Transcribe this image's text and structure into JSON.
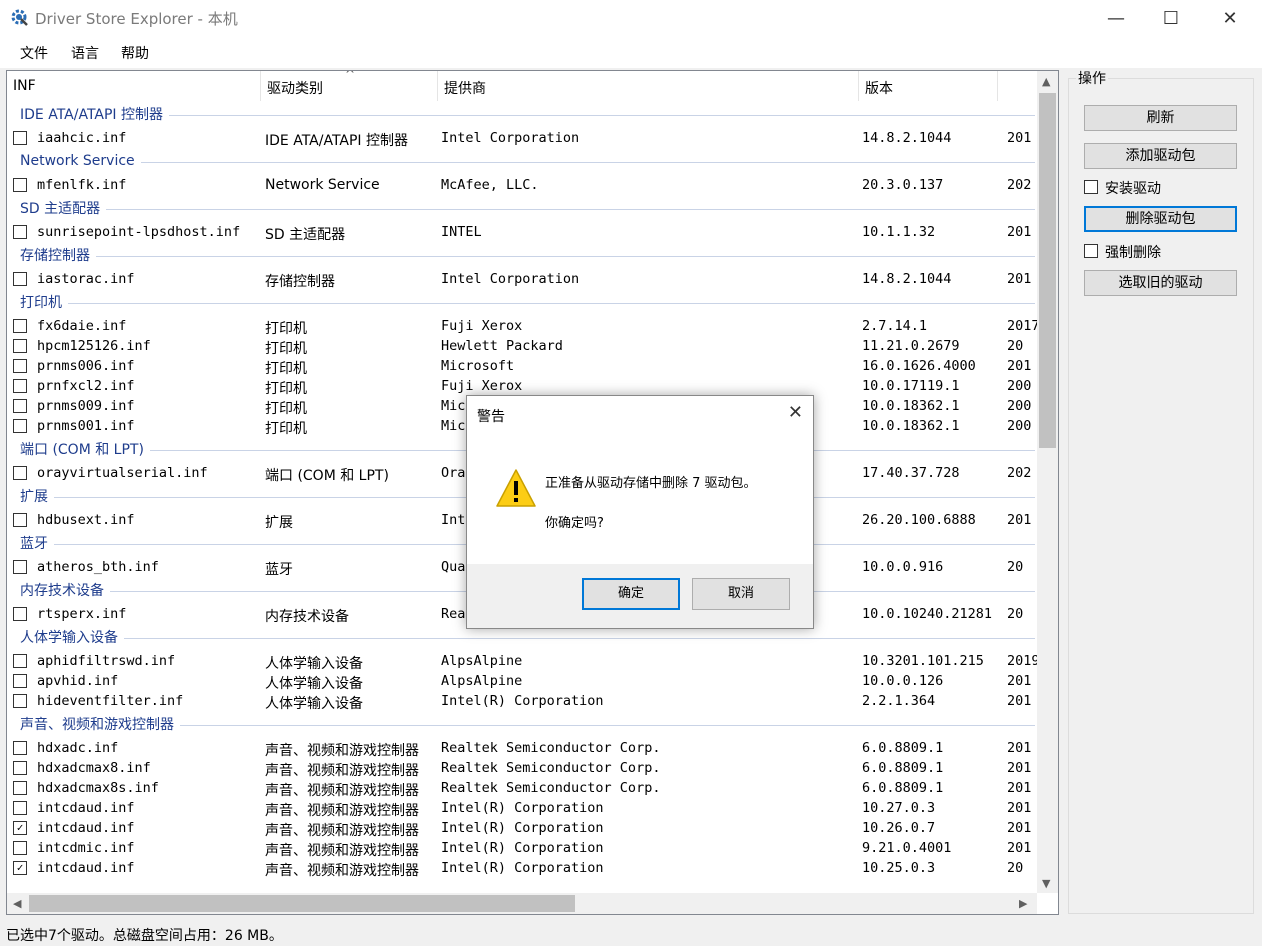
{
  "window": {
    "title": "Driver Store Explorer - 本机",
    "minimize": "—",
    "maximize": "☐",
    "close": "✕"
  },
  "menu": [
    "文件",
    "语言",
    "帮助"
  ],
  "columns": {
    "inf": "INF",
    "type": "驱动类别",
    "provider": "提供商",
    "version": "版本",
    "sort_indicator": "^"
  },
  "list": [
    {
      "group": "IDE ATA/ATAPI 控制器"
    },
    {
      "inf": "iaahcic.inf",
      "type": "IDE ATA/ATAPI 控制器",
      "provider": "Intel Corporation",
      "version": "14.8.2.1044",
      "date": "201",
      "checked": false
    },
    {
      "group": "Network Service"
    },
    {
      "inf": "mfenlfk.inf",
      "type": "Network Service",
      "provider": "McAfee, LLC.",
      "version": "20.3.0.137",
      "date": "202",
      "checked": false
    },
    {
      "group": "SD 主适配器"
    },
    {
      "inf": "sunrisepoint-lpsdhost.inf",
      "type": "SD 主适配器",
      "provider": "INTEL",
      "version": "10.1.1.32",
      "date": "201",
      "checked": false
    },
    {
      "group": "存储控制器"
    },
    {
      "inf": "iastorac.inf",
      "type": "存储控制器",
      "provider": "Intel Corporation",
      "version": "14.8.2.1044",
      "date": "201",
      "checked": false
    },
    {
      "group": "打印机"
    },
    {
      "inf": "fx6daie.inf",
      "type": "打印机",
      "provider": "Fuji Xerox",
      "version": "2.7.14.1",
      "date": "2017",
      "checked": false
    },
    {
      "inf": "hpcm125126.inf",
      "type": "打印机",
      "provider": "Hewlett Packard",
      "version": "11.21.0.2679",
      "date": "20",
      "checked": false
    },
    {
      "inf": "prnms006.inf",
      "type": "打印机",
      "provider": "Microsoft",
      "version": "16.0.1626.4000",
      "date": "201",
      "checked": false
    },
    {
      "inf": "prnfxcl2.inf",
      "type": "打印机",
      "provider": "Fuji Xerox",
      "version": "10.0.17119.1",
      "date": "200",
      "checked": false
    },
    {
      "inf": "prnms009.inf",
      "type": "打印机",
      "provider": "Mic",
      "version": "10.0.18362.1",
      "date": "200",
      "checked": false
    },
    {
      "inf": "prnms001.inf",
      "type": "打印机",
      "provider": "Mic",
      "version": "10.0.18362.1",
      "date": "200",
      "checked": false
    },
    {
      "group": "端口 (COM 和 LPT)"
    },
    {
      "inf": "orayvirtualserial.inf",
      "type": "端口 (COM 和 LPT)",
      "provider": "Ora",
      "version": "17.40.37.728",
      "date": "202",
      "checked": false
    },
    {
      "group": "扩展"
    },
    {
      "inf": "hdbusext.inf",
      "type": "扩展",
      "provider": "Int",
      "version": "26.20.100.6888",
      "date": "201",
      "checked": false
    },
    {
      "group": "蓝牙"
    },
    {
      "inf": "atheros_bth.inf",
      "type": "蓝牙",
      "provider": "Qua",
      "version": "10.0.0.916",
      "date": "20",
      "checked": false
    },
    {
      "group": "内存技术设备"
    },
    {
      "inf": "rtsperx.inf",
      "type": "内存技术设备",
      "provider": "Realtek Semiconduct Corp.",
      "version": "10.0.10240.21281",
      "date": "20",
      "checked": false
    },
    {
      "group": "人体学输入设备"
    },
    {
      "inf": "aphidfiltrswd.inf",
      "type": "人体学输入设备",
      "provider": "AlpsAlpine",
      "version": "10.3201.101.215",
      "date": "2019",
      "checked": false
    },
    {
      "inf": "apvhid.inf",
      "type": "人体学输入设备",
      "provider": "AlpsAlpine",
      "version": "10.0.0.126",
      "date": "201",
      "checked": false
    },
    {
      "inf": "hideventfilter.inf",
      "type": "人体学输入设备",
      "provider": "Intel(R) Corporation",
      "version": "2.2.1.364",
      "date": "201",
      "checked": false
    },
    {
      "group": "声音、视频和游戏控制器"
    },
    {
      "inf": "hdxadc.inf",
      "type": "声音、视频和游戏控制器",
      "provider": "Realtek Semiconductor Corp.",
      "version": "6.0.8809.1",
      "date": "201",
      "checked": false
    },
    {
      "inf": "hdxadcmax8.inf",
      "type": "声音、视频和游戏控制器",
      "provider": "Realtek Semiconductor Corp.",
      "version": "6.0.8809.1",
      "date": "201",
      "checked": false
    },
    {
      "inf": "hdxadcmax8s.inf",
      "type": "声音、视频和游戏控制器",
      "provider": "Realtek Semiconductor Corp.",
      "version": "6.0.8809.1",
      "date": "201",
      "checked": false
    },
    {
      "inf": "intcdaud.inf",
      "type": "声音、视频和游戏控制器",
      "provider": "Intel(R) Corporation",
      "version": "10.27.0.3",
      "date": "201",
      "checked": false
    },
    {
      "inf": "intcdaud.inf",
      "type": "声音、视频和游戏控制器",
      "provider": "Intel(R) Corporation",
      "version": "10.26.0.7",
      "date": "201",
      "checked": true
    },
    {
      "inf": "intcdmic.inf",
      "type": "声音、视频和游戏控制器",
      "provider": "Intel(R) Corporation",
      "version": "9.21.0.4001",
      "date": "201",
      "checked": false
    },
    {
      "inf": "intcdaud.inf",
      "type": "声音、视频和游戏控制器",
      "provider": "Intel(R) Corporation",
      "version": "10.25.0.3",
      "date": "20",
      "checked": true
    }
  ],
  "ops": {
    "title": "操作",
    "refresh": "刷新",
    "add_driver": "添加驱动包",
    "install_driver": "安装驱动",
    "delete_driver": "删除驱动包",
    "force_delete": "强制删除",
    "select_old": "选取旧的驱动"
  },
  "status": "已选中7个驱动。总磁盘空间占用：26 MB。",
  "dialog": {
    "title": "警告",
    "message": "正准备从驱动存储中删除 7 驱动包。",
    "question": "你确定吗?",
    "ok": "确定",
    "cancel": "取消"
  }
}
